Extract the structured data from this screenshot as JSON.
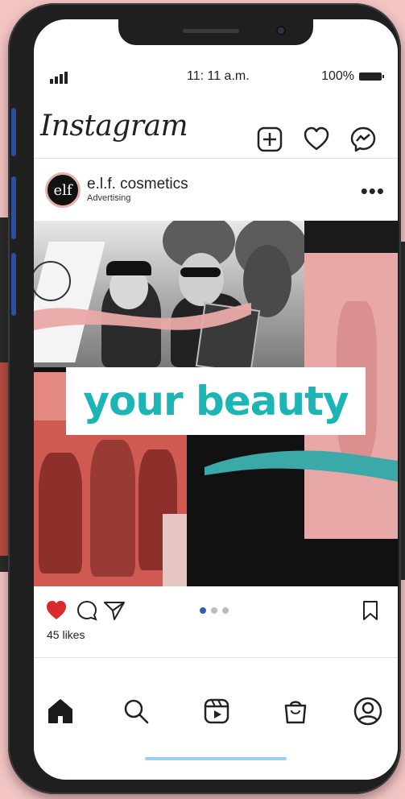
{
  "status_bar": {
    "time": "11: 11 a.m.",
    "battery": "100%"
  },
  "header": {
    "logo": "Instagram"
  },
  "post": {
    "avatar_text": "elf",
    "account": "e.l.f. cosmetics",
    "sponsored": "Advertising",
    "banner_text": "your beauty",
    "likes": "45 likes",
    "carousel": {
      "count": 3,
      "active": 1
    }
  },
  "colors": {
    "accent_teal": "#1bb5b5",
    "like_red": "#d92b2b",
    "dot_active": "#2a62b6",
    "bg_pink": "#f2c4c2"
  },
  "icons": {
    "header": [
      "add-post-icon",
      "heart-icon",
      "messenger-icon"
    ],
    "actions": [
      "like-icon",
      "comment-icon",
      "share-icon",
      "save-icon"
    ],
    "nav": [
      "home-icon",
      "search-icon",
      "reels-icon",
      "shop-icon",
      "profile-icon"
    ]
  }
}
